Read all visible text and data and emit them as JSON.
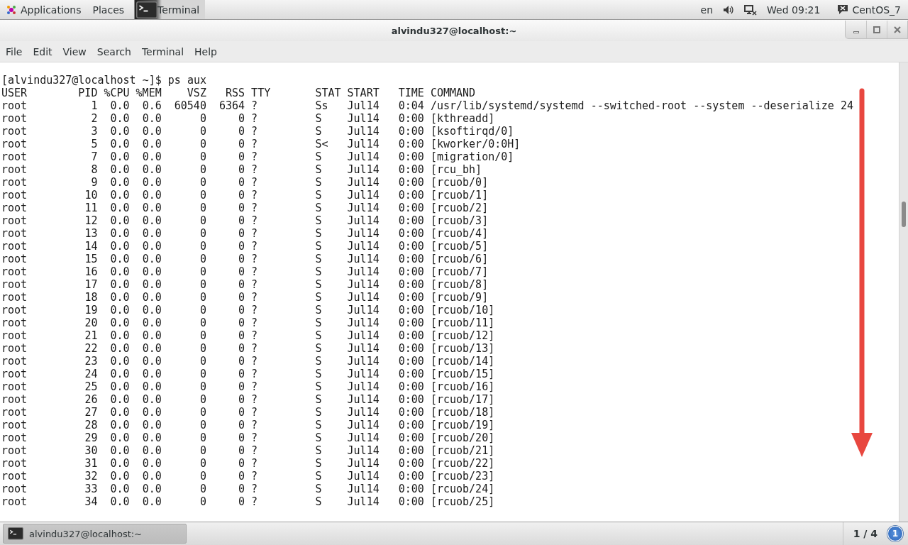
{
  "top_bar": {
    "applications": "Applications",
    "places": "Places",
    "active_app": "Terminal",
    "language": "en",
    "clock": "Wed 09:21",
    "user": "CentOS_7"
  },
  "window": {
    "title": "alvindu327@localhost:~"
  },
  "menu": [
    "File",
    "Edit",
    "View",
    "Search",
    "Terminal",
    "Help"
  ],
  "terminal": {
    "prompt": "[alvindu327@localhost ~]$ ps aux",
    "columns": [
      "USER",
      "PID",
      "%CPU",
      "%MEM",
      "VSZ",
      "RSS",
      "TTY",
      "STAT",
      "START",
      "TIME",
      "COMMAND"
    ],
    "rows": [
      [
        "root",
        "1",
        "0.0",
        "0.6",
        "60540",
        "6364",
        "?",
        "Ss",
        "Jul14",
        "0:04",
        "/usr/lib/systemd/systemd --switched-root --system --deserialize 24"
      ],
      [
        "root",
        "2",
        "0.0",
        "0.0",
        "0",
        "0",
        "?",
        "S",
        "Jul14",
        "0:00",
        "[kthreadd]"
      ],
      [
        "root",
        "3",
        "0.0",
        "0.0",
        "0",
        "0",
        "?",
        "S",
        "Jul14",
        "0:00",
        "[ksoftirqd/0]"
      ],
      [
        "root",
        "5",
        "0.0",
        "0.0",
        "0",
        "0",
        "?",
        "S<",
        "Jul14",
        "0:00",
        "[kworker/0:0H]"
      ],
      [
        "root",
        "7",
        "0.0",
        "0.0",
        "0",
        "0",
        "?",
        "S",
        "Jul14",
        "0:00",
        "[migration/0]"
      ],
      [
        "root",
        "8",
        "0.0",
        "0.0",
        "0",
        "0",
        "?",
        "S",
        "Jul14",
        "0:00",
        "[rcu_bh]"
      ],
      [
        "root",
        "9",
        "0.0",
        "0.0",
        "0",
        "0",
        "?",
        "S",
        "Jul14",
        "0:00",
        "[rcuob/0]"
      ],
      [
        "root",
        "10",
        "0.0",
        "0.0",
        "0",
        "0",
        "?",
        "S",
        "Jul14",
        "0:00",
        "[rcuob/1]"
      ],
      [
        "root",
        "11",
        "0.0",
        "0.0",
        "0",
        "0",
        "?",
        "S",
        "Jul14",
        "0:00",
        "[rcuob/2]"
      ],
      [
        "root",
        "12",
        "0.0",
        "0.0",
        "0",
        "0",
        "?",
        "S",
        "Jul14",
        "0:00",
        "[rcuob/3]"
      ],
      [
        "root",
        "13",
        "0.0",
        "0.0",
        "0",
        "0",
        "?",
        "S",
        "Jul14",
        "0:00",
        "[rcuob/4]"
      ],
      [
        "root",
        "14",
        "0.0",
        "0.0",
        "0",
        "0",
        "?",
        "S",
        "Jul14",
        "0:00",
        "[rcuob/5]"
      ],
      [
        "root",
        "15",
        "0.0",
        "0.0",
        "0",
        "0",
        "?",
        "S",
        "Jul14",
        "0:00",
        "[rcuob/6]"
      ],
      [
        "root",
        "16",
        "0.0",
        "0.0",
        "0",
        "0",
        "?",
        "S",
        "Jul14",
        "0:00",
        "[rcuob/7]"
      ],
      [
        "root",
        "17",
        "0.0",
        "0.0",
        "0",
        "0",
        "?",
        "S",
        "Jul14",
        "0:00",
        "[rcuob/8]"
      ],
      [
        "root",
        "18",
        "0.0",
        "0.0",
        "0",
        "0",
        "?",
        "S",
        "Jul14",
        "0:00",
        "[rcuob/9]"
      ],
      [
        "root",
        "19",
        "0.0",
        "0.0",
        "0",
        "0",
        "?",
        "S",
        "Jul14",
        "0:00",
        "[rcuob/10]"
      ],
      [
        "root",
        "20",
        "0.0",
        "0.0",
        "0",
        "0",
        "?",
        "S",
        "Jul14",
        "0:00",
        "[rcuob/11]"
      ],
      [
        "root",
        "21",
        "0.0",
        "0.0",
        "0",
        "0",
        "?",
        "S",
        "Jul14",
        "0:00",
        "[rcuob/12]"
      ],
      [
        "root",
        "22",
        "0.0",
        "0.0",
        "0",
        "0",
        "?",
        "S",
        "Jul14",
        "0:00",
        "[rcuob/13]"
      ],
      [
        "root",
        "23",
        "0.0",
        "0.0",
        "0",
        "0",
        "?",
        "S",
        "Jul14",
        "0:00",
        "[rcuob/14]"
      ],
      [
        "root",
        "24",
        "0.0",
        "0.0",
        "0",
        "0",
        "?",
        "S",
        "Jul14",
        "0:00",
        "[rcuob/15]"
      ],
      [
        "root",
        "25",
        "0.0",
        "0.0",
        "0",
        "0",
        "?",
        "S",
        "Jul14",
        "0:00",
        "[rcuob/16]"
      ],
      [
        "root",
        "26",
        "0.0",
        "0.0",
        "0",
        "0",
        "?",
        "S",
        "Jul14",
        "0:00",
        "[rcuob/17]"
      ],
      [
        "root",
        "27",
        "0.0",
        "0.0",
        "0",
        "0",
        "?",
        "S",
        "Jul14",
        "0:00",
        "[rcuob/18]"
      ],
      [
        "root",
        "28",
        "0.0",
        "0.0",
        "0",
        "0",
        "?",
        "S",
        "Jul14",
        "0:00",
        "[rcuob/19]"
      ],
      [
        "root",
        "29",
        "0.0",
        "0.0",
        "0",
        "0",
        "?",
        "S",
        "Jul14",
        "0:00",
        "[rcuob/20]"
      ],
      [
        "root",
        "30",
        "0.0",
        "0.0",
        "0",
        "0",
        "?",
        "S",
        "Jul14",
        "0:00",
        "[rcuob/21]"
      ],
      [
        "root",
        "31",
        "0.0",
        "0.0",
        "0",
        "0",
        "?",
        "S",
        "Jul14",
        "0:00",
        "[rcuob/22]"
      ],
      [
        "root",
        "32",
        "0.0",
        "0.0",
        "0",
        "0",
        "?",
        "S",
        "Jul14",
        "0:00",
        "[rcuob/23]"
      ],
      [
        "root",
        "33",
        "0.0",
        "0.0",
        "0",
        "0",
        "?",
        "S",
        "Jul14",
        "0:00",
        "[rcuob/24]"
      ],
      [
        "root",
        "34",
        "0.0",
        "0.0",
        "0",
        "0",
        "?",
        "S",
        "Jul14",
        "0:00",
        "[rcuob/25]"
      ]
    ]
  },
  "taskbar": {
    "task": "alvindu327@localhost:~",
    "workspace": "1 / 4",
    "notifications": "1"
  }
}
